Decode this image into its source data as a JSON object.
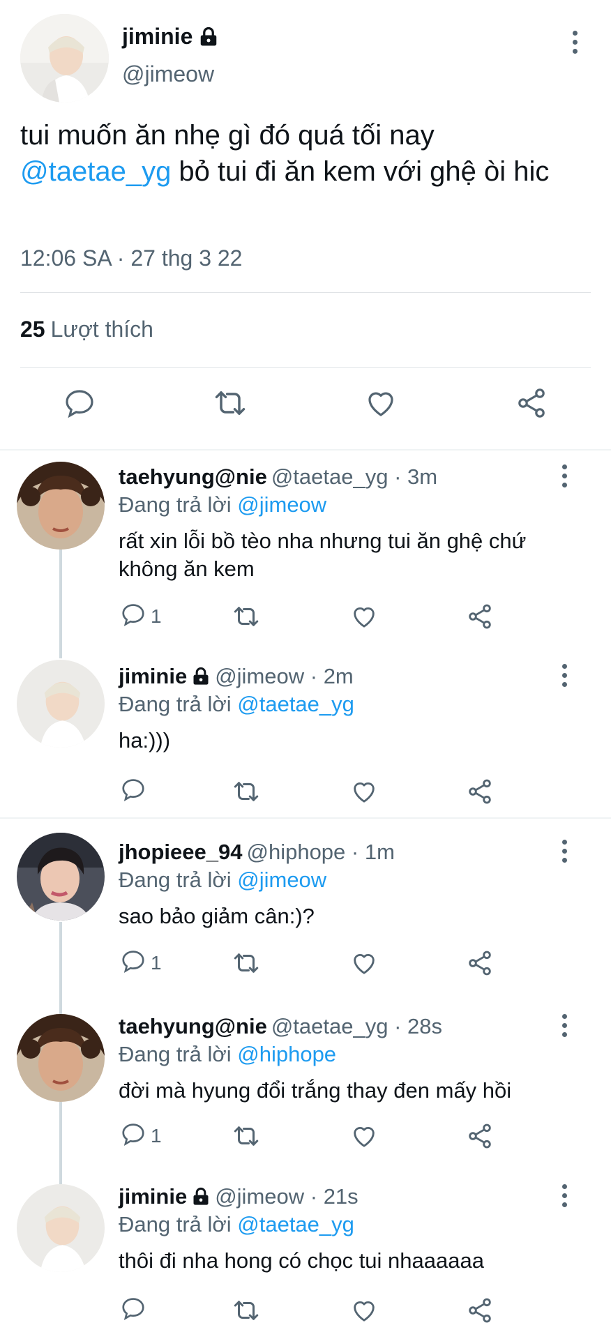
{
  "main_tweet": {
    "name": "jiminie",
    "handle": "@jimeow",
    "text_part1": "tui muốn ăn nhẹ gì đó quá tối nay ",
    "mention": "@taetae_yg",
    "text_part2": " bỏ tui đi ăn kem với ghệ òi hic",
    "timestamp": "12:06 SA · 27 thg 3 22",
    "like_count": "25",
    "like_label": "Lượt thích"
  },
  "replies": [
    {
      "name": "taehyung@nie",
      "handle": "@taetae_yg · 3m",
      "replying_prefix": "Đang trả lời",
      "replying_to": "@jimeow",
      "text": "rất xin lỗi bồ tèo nha nhưng tui ăn ghệ chứ không ăn kem",
      "reply_count": "1"
    },
    {
      "name": "jiminie",
      "handle": "@jimeow · 2m",
      "replying_prefix": "Đang trả lời",
      "replying_to": "@taetae_yg",
      "text": "ha:)))",
      "reply_count": ""
    },
    {
      "name": "jhopieee_94",
      "handle": "@hiphope · 1m",
      "replying_prefix": "Đang trả lời",
      "replying_to": "@jimeow",
      "text": "sao bảo giảm cân:)?",
      "reply_count": "1"
    },
    {
      "name": "taehyung@nie",
      "handle": "@taetae_yg · 28s",
      "replying_prefix": "Đang trả lời",
      "replying_to": "@hiphope",
      "text": "đời mà hyung đổi trắng thay đen mấy hồi",
      "reply_count": "1"
    },
    {
      "name": "jiminie",
      "handle": "@jimeow · 21s",
      "replying_prefix": "Đang trả lời",
      "replying_to": "@taetae_yg",
      "text": "thôi đi nha hong có chọc tui nhaaaaaa",
      "reply_count": ""
    }
  ],
  "colors": {
    "link": "#1d9bf0",
    "secondary_text": "#536471",
    "primary_text": "#0f1419",
    "divider": "#dfe3e6"
  },
  "icons": [
    "lock-icon",
    "more-icon",
    "reply-icon",
    "retweet-icon",
    "like-icon",
    "share-icon"
  ]
}
